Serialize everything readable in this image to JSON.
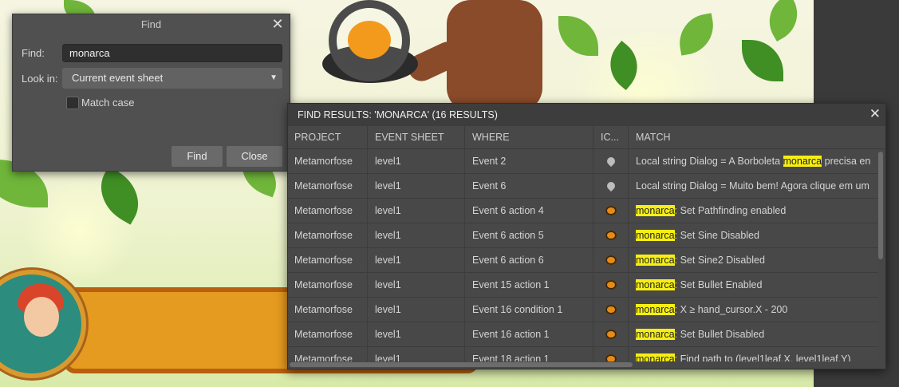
{
  "find_dialog": {
    "title": "Find",
    "find_label": "Find:",
    "find_value": "monarca",
    "lookin_label": "Look in:",
    "lookin_value": "Current event sheet",
    "match_case_label": "Match case",
    "match_case_checked": false,
    "find_button": "Find",
    "close_button": "Close"
  },
  "results": {
    "title": "FIND RESULTS: 'MONARCA' (16 RESULTS)",
    "columns": [
      "PROJECT",
      "EVENT SHEET",
      "WHERE",
      "IC...",
      "MATCH"
    ],
    "highlight_color": "#f7ef14",
    "rows": [
      {
        "project": "Metamorfose",
        "sheet": "level1",
        "where": "Event 2",
        "icon": "location-pin-icon",
        "pre": "Local string Dialog = A Borboleta ",
        "hit": "monarca",
        "post": " precisa en"
      },
      {
        "project": "Metamorfose",
        "sheet": "level1",
        "where": "Event 6",
        "icon": "location-pin-icon",
        "pre": "Local string Dialog = Muito bem! Agora clique em um",
        "hit": "",
        "post": ""
      },
      {
        "project": "Metamorfose",
        "sheet": "level1",
        "where": "Event 6 action 4",
        "icon": "butterfly-icon",
        "pre": "",
        "hit": "monarca",
        "post": ": Set Pathfinding enabled"
      },
      {
        "project": "Metamorfose",
        "sheet": "level1",
        "where": "Event 6 action 5",
        "icon": "butterfly-icon",
        "pre": "",
        "hit": "monarca",
        "post": ": Set Sine Disabled"
      },
      {
        "project": "Metamorfose",
        "sheet": "level1",
        "where": "Event 6 action 6",
        "icon": "butterfly-icon",
        "pre": "",
        "hit": "monarca",
        "post": ": Set Sine2 Disabled"
      },
      {
        "project": "Metamorfose",
        "sheet": "level1",
        "where": "Event 15 action 1",
        "icon": "butterfly-icon",
        "pre": "",
        "hit": "monarca",
        "post": ": Set Bullet Enabled"
      },
      {
        "project": "Metamorfose",
        "sheet": "level1",
        "where": "Event 16 condition 1",
        "icon": "butterfly-icon",
        "pre": "",
        "hit": "monarca",
        "post": ": X ≥ hand_cursor.X - 200"
      },
      {
        "project": "Metamorfose",
        "sheet": "level1",
        "where": "Event 16 action 1",
        "icon": "butterfly-icon",
        "pre": "",
        "hit": "monarca",
        "post": ": Set Bullet Disabled"
      },
      {
        "project": "Metamorfose",
        "sheet": "level1",
        "where": "Event 18 action 1",
        "icon": "butterfly-icon",
        "pre": "",
        "hit": "monarca",
        "post": ": Find path to (level1leaf.X, level1leaf.Y)"
      }
    ]
  }
}
